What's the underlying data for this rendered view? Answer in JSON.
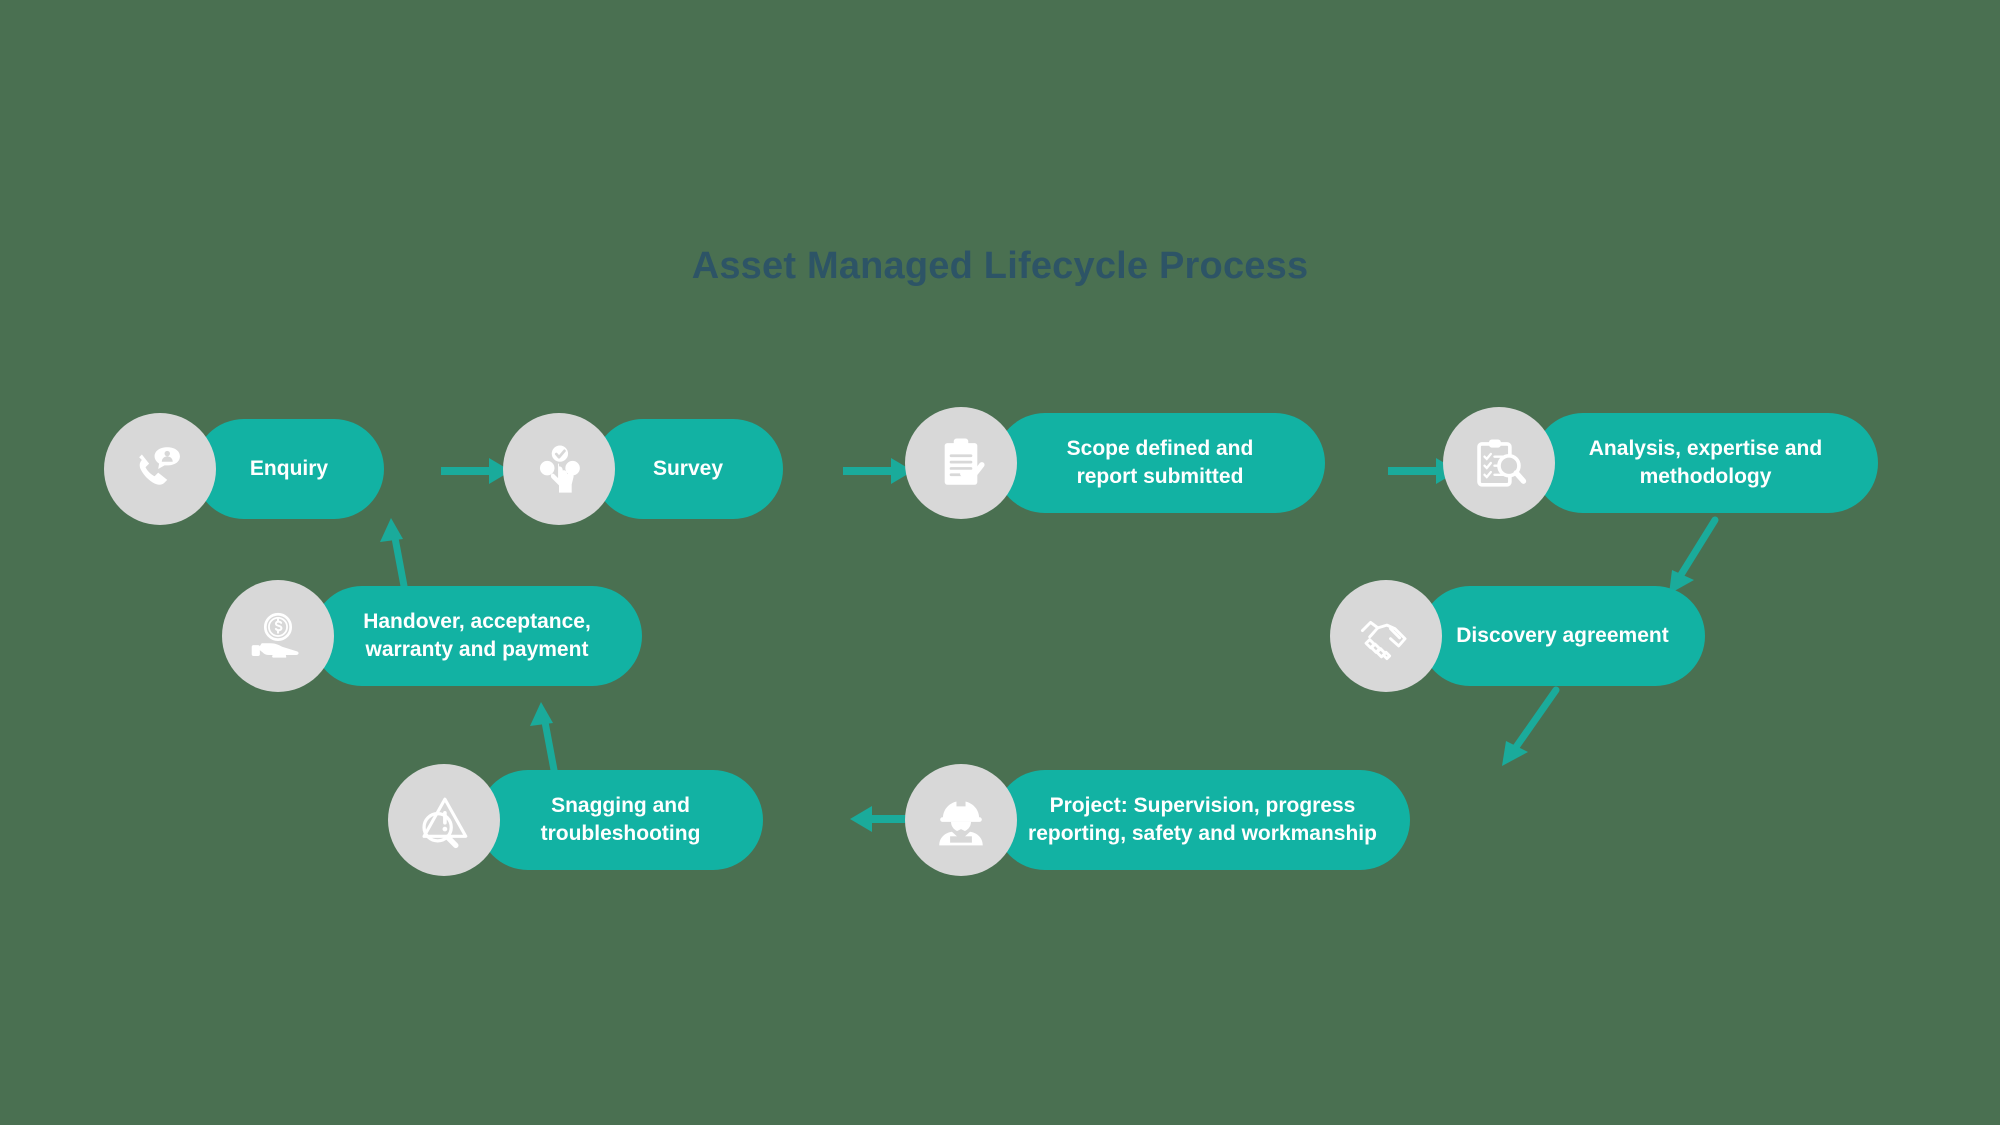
{
  "title": "Asset Managed Lifecycle Process",
  "colors": {
    "background": "#4a7051",
    "pill": "#12b2a3",
    "icon_circle": "#d8d8d8",
    "icon_glyph": "#ffffff",
    "arrow": "#1aab9b",
    "title": "#2d5466",
    "pill_text": "#ffffff"
  },
  "chart_data": {
    "type": "diagram",
    "title": "Asset Managed Lifecycle Process",
    "layout": "cyclical process flow, 3 rows, clockwise",
    "node_count": 8,
    "nodes": [
      {
        "id": "enquiry",
        "label": "Enquiry",
        "lines": [
          "Enquiry"
        ],
        "icon": "phone-call-person-icon",
        "row": 1,
        "order": 1
      },
      {
        "id": "survey",
        "label": "Survey",
        "lines": [
          "Survey"
        ],
        "icon": "hand-select-check-icon",
        "row": 1,
        "order": 2
      },
      {
        "id": "scope",
        "label": "Scope defined and report submitted",
        "lines": [
          "Scope defined and",
          "report submitted"
        ],
        "icon": "clipboard-check-icon",
        "row": 1,
        "order": 3
      },
      {
        "id": "analysis",
        "label": "Analysis, expertise and methodology",
        "lines": [
          "Analysis, expertise and",
          "methodology"
        ],
        "icon": "clipboard-magnifier-icon",
        "row": 1,
        "order": 4
      },
      {
        "id": "discovery",
        "label": "Discovery agreement",
        "lines": [
          "Discovery agreement"
        ],
        "icon": "handshake-icon",
        "row": 2,
        "order": 5
      },
      {
        "id": "project",
        "label": "Project: Supervision, progress reporting, safety and workmanship",
        "lines": [
          "Project: Supervision, progress",
          "reporting, safety and workmanship"
        ],
        "icon": "construction-worker-icon",
        "row": 3,
        "order": 6
      },
      {
        "id": "snagging",
        "label": "Snagging and troubleshooting",
        "lines": [
          "Snagging and",
          "troubleshooting"
        ],
        "icon": "warning-magnifier-icon",
        "row": 3,
        "order": 7
      },
      {
        "id": "handover",
        "label": "Handover, acceptance, warranty and payment",
        "lines": [
          "Handover, acceptance,",
          "warranty and payment"
        ],
        "icon": "hand-coin-icon",
        "row": 2,
        "order": 8
      }
    ],
    "edges": [
      {
        "from": "enquiry",
        "to": "survey",
        "direction": "right"
      },
      {
        "from": "survey",
        "to": "scope",
        "direction": "right"
      },
      {
        "from": "scope",
        "to": "analysis",
        "direction": "right"
      },
      {
        "from": "analysis",
        "to": "discovery",
        "direction": "down-left"
      },
      {
        "from": "discovery",
        "to": "project",
        "direction": "down-left"
      },
      {
        "from": "project",
        "to": "snagging",
        "direction": "left"
      },
      {
        "from": "snagging",
        "to": "handover",
        "direction": "up"
      },
      {
        "from": "handover",
        "to": "enquiry",
        "direction": "up"
      }
    ]
  },
  "nodes": {
    "enquiry": {
      "line1": "Enquiry"
    },
    "survey": {
      "line1": "Survey"
    },
    "scope": {
      "line1": "Scope defined and",
      "line2": "report submitted"
    },
    "analysis": {
      "line1": "Analysis, expertise and",
      "line2": "methodology"
    },
    "discovery": {
      "line1": "Discovery agreement"
    },
    "project": {
      "line1": "Project: Supervision, progress",
      "line2": "reporting, safety and workmanship"
    },
    "snagging": {
      "line1": "Snagging and",
      "line2": "troubleshooting"
    },
    "handover": {
      "line1": "Handover, acceptance,",
      "line2": "warranty and payment"
    }
  }
}
